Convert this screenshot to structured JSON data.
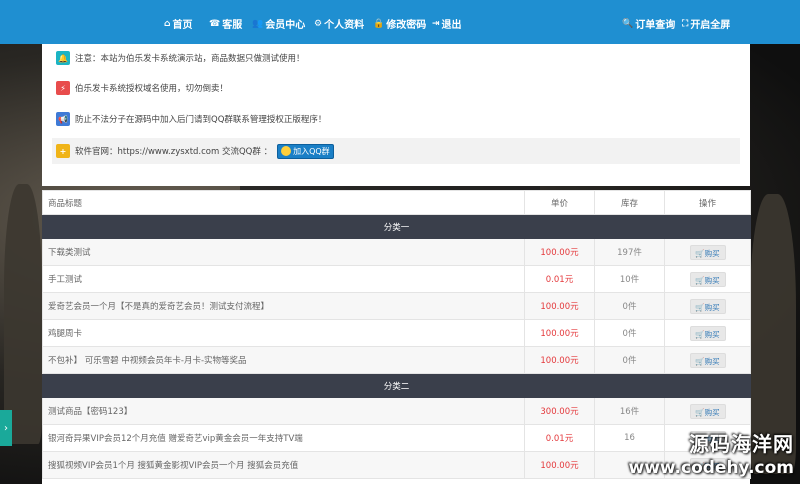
{
  "nav": {
    "left": [
      {
        "icon": "home-icon",
        "glyph": "⌂",
        "label": "首页"
      },
      {
        "icon": "headset-icon",
        "glyph": "☎",
        "label": "客服"
      },
      {
        "icon": "users-icon",
        "glyph": "👥",
        "label": "会员中心"
      },
      {
        "icon": "gear-icon",
        "glyph": "⚙",
        "label": "个人资料"
      },
      {
        "icon": "lock-icon",
        "glyph": "🔒",
        "label": "修改密码"
      },
      {
        "icon": "logout-icon",
        "glyph": "⇥",
        "label": "退出"
      }
    ],
    "right": [
      {
        "icon": "search-icon",
        "glyph": "🔍",
        "label": "订单查询"
      },
      {
        "icon": "fullscreen-icon",
        "glyph": "⛶",
        "label": "开启全屏"
      }
    ]
  },
  "notices": [
    {
      "icon": "bell-icon",
      "glyph": "🔔",
      "color": "#1bb4c4",
      "text": "注意：本站为伯乐发卡系统演示站，商品数据只做测试使用！"
    },
    {
      "icon": "bolt-icon",
      "glyph": "⚡",
      "color": "#e84c4c",
      "text": "伯乐发卡系统授权域名使用，切勿倒卖！"
    },
    {
      "icon": "megaphone-icon",
      "glyph": "📢",
      "color": "#3f7ad6",
      "text": "防止不法分子在源码中加入后门请到QQ群联系管理授权正版程序！"
    }
  ],
  "official": {
    "icon": "plus-icon",
    "glyph": "+",
    "color": "#f0b418",
    "text": "软件官网：https://www.zysxtd.com 交流QQ群 ：",
    "qq_button": "加入QQ群"
  },
  "table": {
    "headers": [
      "商品标题",
      "单价",
      "库存",
      "操作"
    ],
    "categories": [
      {
        "name": "分类一",
        "rows": [
          {
            "title": "下载类测试",
            "price": "100.00元",
            "stock": "197件",
            "action": "购买"
          },
          {
            "title": "手工测试",
            "price": "0.01元",
            "stock": "10件",
            "action": "购买"
          },
          {
            "title": "爱奇艺会员一个月【不是真的爱奇艺会员！测试支付流程】",
            "price": "100.00元",
            "stock": "0件",
            "action": "购买"
          },
          {
            "title": "鸡腿周卡",
            "price": "100.00元",
            "stock": "0件",
            "action": "购买"
          },
          {
            "title": "不包补】 可乐雪碧 中视频会员年卡-月卡-实物等奖品",
            "price": "100.00元",
            "stock": "0件",
            "action": "购买"
          }
        ]
      },
      {
        "name": "分类二",
        "rows": [
          {
            "title": "测试商品【密码123】",
            "price": "300.00元",
            "stock": "16件",
            "action": "购买"
          },
          {
            "title": "银河奇异果VIP会员12个月充值 赠爱奇艺vip黄金会员一年支持TV端",
            "price": "0.01元",
            "stock": "16",
            "action": "购买"
          },
          {
            "title": "搜狐视频VIP会员1个月 搜狐黄金影视VIP会员一个月 搜狐会员充值",
            "price": "100.00元",
            "stock": "",
            "action": "购买"
          }
        ]
      }
    ]
  },
  "side_tab": {
    "glyph": "›"
  },
  "watermark": {
    "line1": "源码海洋网",
    "line2": "www.codehy.com"
  }
}
